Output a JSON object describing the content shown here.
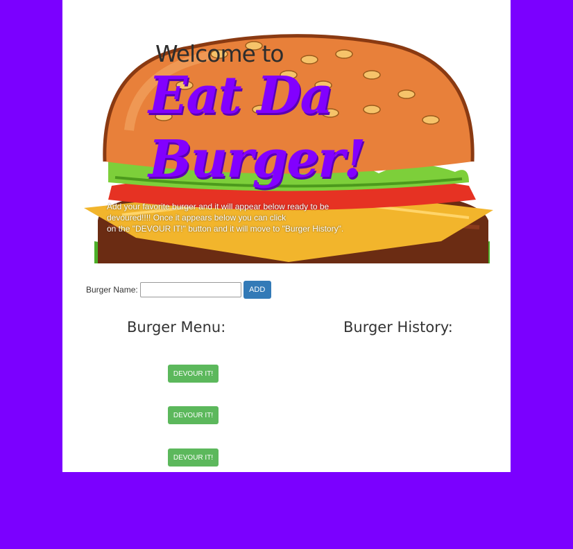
{
  "hero": {
    "welcome": "Welcome to",
    "brand_line1": "Eat Da",
    "brand_line2": "Burger!",
    "intro_line1": "Add your favorite burger and it will appear below ready to be",
    "intro_line2": "devoured!!!! Once it appears below you can click",
    "intro_line3": "on the \"DEVOUR IT!\" button and it will move to \"Burger History\"."
  },
  "form": {
    "label": "Burger Name:",
    "input_value": "",
    "add_label": "ADD"
  },
  "menu": {
    "title": "Burger Menu:",
    "items": [
      {
        "button_label": "DEVOUR IT!"
      },
      {
        "button_label": "DEVOUR IT!"
      },
      {
        "button_label": "DEVOUR IT!"
      }
    ]
  },
  "history": {
    "title": "Burger History:"
  },
  "colors": {
    "page_background": "#7b00ff",
    "brand": "#8200ff",
    "add_button": "#337ab7",
    "devour_button": "#5cb85c"
  }
}
